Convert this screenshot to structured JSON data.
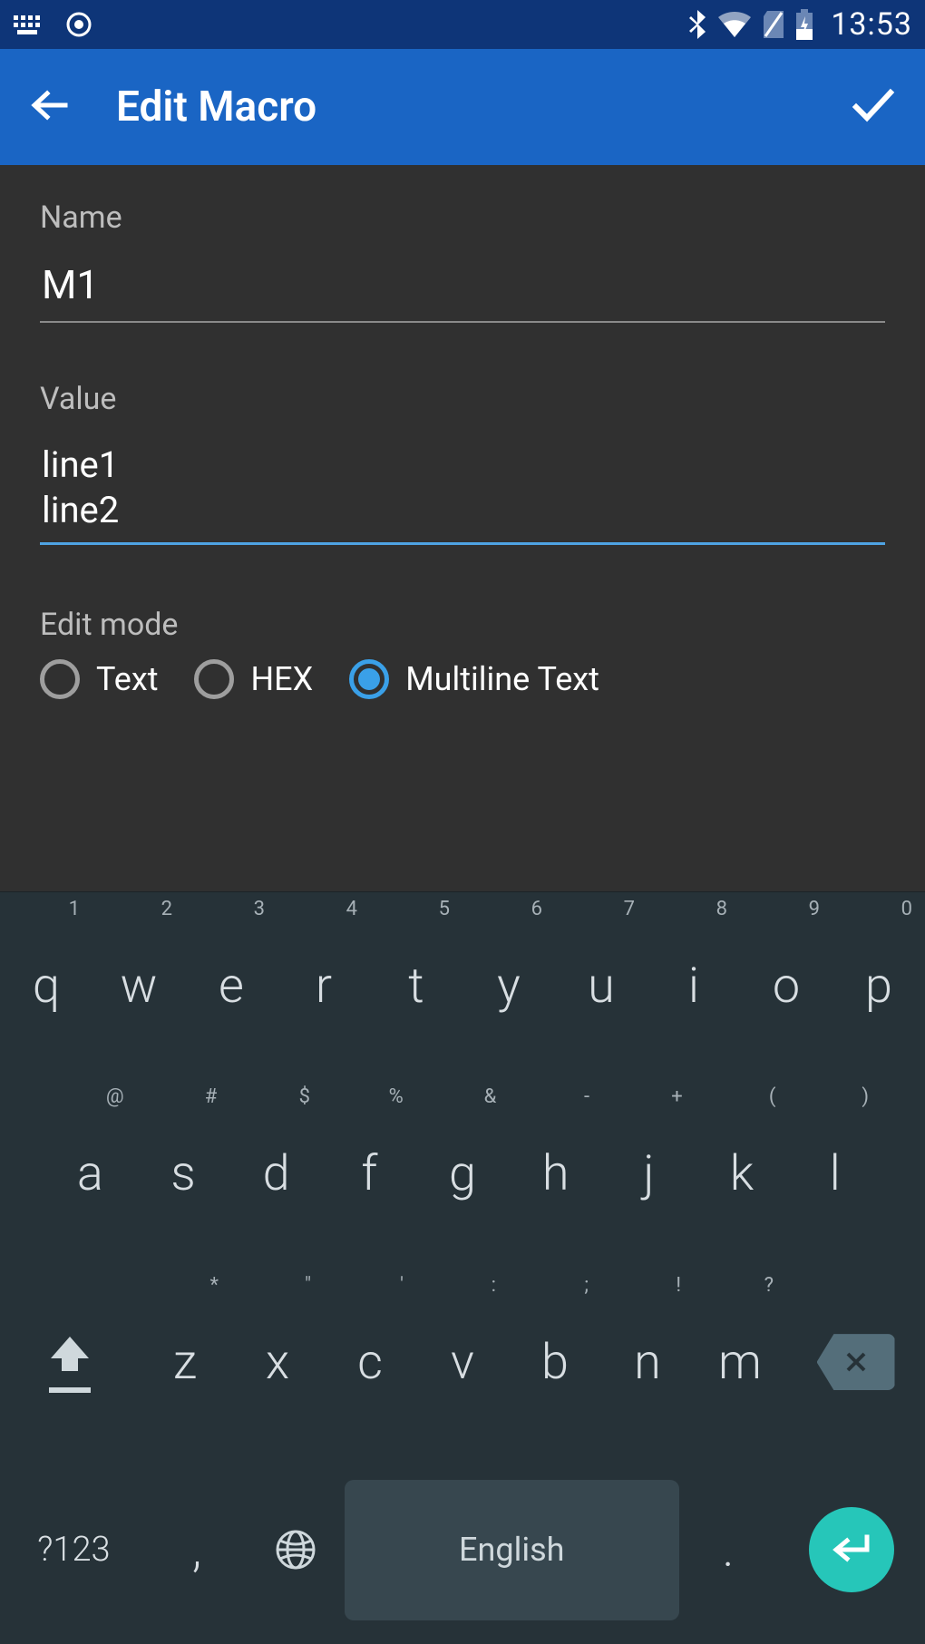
{
  "status": {
    "time": "13:53"
  },
  "appbar": {
    "title": "Edit Macro"
  },
  "form": {
    "name_label": "Name",
    "name_value": "M1",
    "value_label": "Value",
    "value_text": "line1\nline2",
    "mode_label": "Edit mode",
    "modes": {
      "text": "Text",
      "hex": "HEX",
      "multiline": "Multiline Text"
    },
    "selected_mode": "multiline"
  },
  "keyboard": {
    "row1": [
      {
        "m": "q",
        "s": "1"
      },
      {
        "m": "w",
        "s": "2"
      },
      {
        "m": "e",
        "s": "3"
      },
      {
        "m": "r",
        "s": "4"
      },
      {
        "m": "t",
        "s": "5"
      },
      {
        "m": "y",
        "s": "6"
      },
      {
        "m": "u",
        "s": "7"
      },
      {
        "m": "i",
        "s": "8"
      },
      {
        "m": "o",
        "s": "9"
      },
      {
        "m": "p",
        "s": "0"
      }
    ],
    "row2": [
      {
        "m": "a",
        "s": "@"
      },
      {
        "m": "s",
        "s": "#"
      },
      {
        "m": "d",
        "s": "$"
      },
      {
        "m": "f",
        "s": "%"
      },
      {
        "m": "g",
        "s": "&"
      },
      {
        "m": "h",
        "s": "-"
      },
      {
        "m": "j",
        "s": "+"
      },
      {
        "m": "k",
        "s": "("
      },
      {
        "m": "l",
        "s": ")"
      }
    ],
    "row3": [
      {
        "m": "z",
        "s": "*"
      },
      {
        "m": "x",
        "s": "\""
      },
      {
        "m": "c",
        "s": "'"
      },
      {
        "m": "v",
        "s": ":"
      },
      {
        "m": "b",
        "s": ";"
      },
      {
        "m": "n",
        "s": "!"
      },
      {
        "m": "m",
        "s": "?"
      }
    ],
    "sym": "?123",
    "comma": ",",
    "period": ".",
    "space": "English"
  }
}
